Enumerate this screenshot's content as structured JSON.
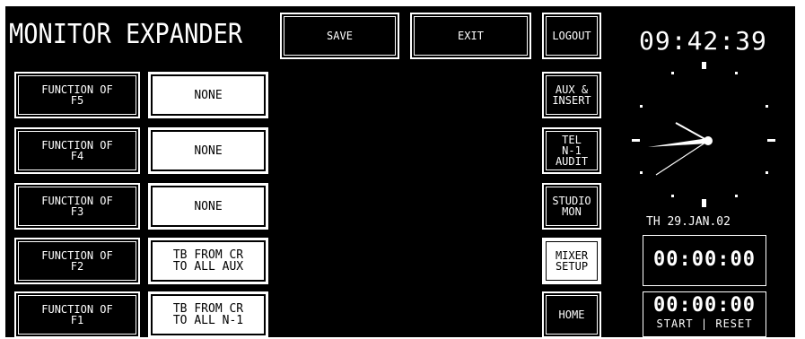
{
  "header": {
    "title": "MONITOR EXPANDER",
    "save_label": "SAVE",
    "exit_label": "EXIT"
  },
  "rows": [
    {
      "function_label": "FUNCTION OF\nF5",
      "value": "NONE"
    },
    {
      "function_label": "FUNCTION OF\nF4",
      "value": "NONE"
    },
    {
      "function_label": "FUNCTION OF\nF3",
      "value": "NONE"
    },
    {
      "function_label": "FUNCTION OF\nF2",
      "value": "TB FROM CR\nTO ALL AUX"
    },
    {
      "function_label": "FUNCTION OF\nF1",
      "value": "TB FROM CR\nTO ALL N-1"
    }
  ],
  "side_menu": [
    {
      "label": "LOGOUT"
    },
    {
      "label": "AUX &\nINSERT"
    },
    {
      "label": "TEL\nN-1\nAUDIT"
    },
    {
      "label": "STUDIO\nMON"
    },
    {
      "label": "MIXER\nSETUP",
      "active": true
    },
    {
      "label": "HOME"
    }
  ],
  "clock": {
    "time": "09:42:39",
    "date": "TH 29.JAN.02",
    "icon": "analog-clock-icon"
  },
  "timer1": {
    "value": "00:00:00"
  },
  "timer2": {
    "value": "00:00:00",
    "start_label": "START",
    "separator": "|",
    "reset_label": "RESET"
  },
  "colors": {
    "background": "#000000",
    "foreground": "#ffffff"
  }
}
